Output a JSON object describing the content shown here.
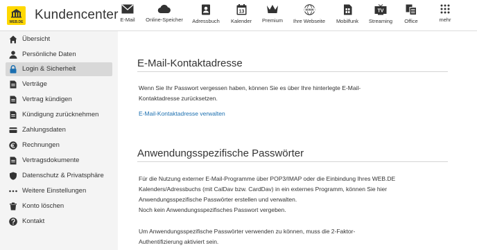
{
  "header": {
    "brand": "Kundencenter",
    "logo_text": "WEB.DE",
    "nav": [
      {
        "label": "E-Mail",
        "icon": "mail-icon"
      },
      {
        "label": "Online-Speicher",
        "icon": "cloud-icon"
      },
      {
        "label": "Adressbuch",
        "icon": "addressbook-icon"
      },
      {
        "label": "Kalender",
        "icon": "calendar-icon",
        "badge": "13"
      },
      {
        "label": "Premium",
        "icon": "crown-icon"
      },
      {
        "label": "Ihre Webseite",
        "icon": "website-icon",
        "badge": "WWW"
      },
      {
        "label": "Mobilfunk",
        "icon": "sim-icon"
      },
      {
        "label": "Streaming",
        "icon": "tv-icon",
        "badge": "TV"
      },
      {
        "label": "Office",
        "icon": "office-icon"
      },
      {
        "label": "mehr",
        "icon": "grid-icon"
      }
    ]
  },
  "sidebar": {
    "items": [
      {
        "label": "Übersicht",
        "icon": "home-icon",
        "active": false
      },
      {
        "label": "Persönliche Daten",
        "icon": "user-icon",
        "active": false
      },
      {
        "label": "Login & Sicherheit",
        "icon": "lock-icon",
        "active": true
      },
      {
        "label": "Verträge",
        "icon": "document-icon",
        "active": false
      },
      {
        "label": "Vertrag kündigen",
        "icon": "document-icon",
        "active": false
      },
      {
        "label": "Kündigung zurücknehmen",
        "icon": "document-icon",
        "active": false
      },
      {
        "label": "Zahlungsdaten",
        "icon": "credit-card-icon",
        "active": false
      },
      {
        "label": "Rechnungen",
        "icon": "euro-icon",
        "active": false
      },
      {
        "label": "Vertragsdokumente",
        "icon": "document-icon",
        "active": false
      },
      {
        "label": "Datenschutz & Privatsphäre",
        "icon": "shield-icon",
        "active": false
      },
      {
        "label": "Weitere Einstellungen",
        "icon": "ellipsis-icon",
        "active": false
      },
      {
        "label": "Konto löschen",
        "icon": "trash-icon",
        "active": false
      },
      {
        "label": "Kontakt",
        "icon": "help-icon",
        "active": false
      }
    ]
  },
  "main": {
    "section1": {
      "title": "E-Mail-Kontaktadresse",
      "text_line1": "Wenn Sie Ihr Passwort vergessen haben, können Sie es über Ihre hinterlegte E-Mail-",
      "text_line2": "Kontaktadresse zurücksetzen.",
      "link": "E-Mail-Kontaktadresse verwalten"
    },
    "section2": {
      "title": "Anwendungsspezifische Passwörter",
      "text_line1": "Für die Nutzung externer E-Mail-Programme über POP3/IMAP oder die Einbindung Ihres WEB.DE",
      "text_line2": "Kalenders/Adressbuchs (mit CalDav bzw. CardDav) in ein externes Programm, können Sie hier",
      "text_line3": "Anwendungsspezifische Passwörter erstellen und verwalten.",
      "text_line4": "Noch kein Anwendungsspezifisches Passwort vergeben.",
      "text_line5": "Um Anwendungsspezifische Passwörter verwenden zu können, muss die 2-Faktor-",
      "text_line6": "Authentifizierung aktiviert sein."
    }
  },
  "colors": {
    "logo_yellow": "#ffd800",
    "link_blue": "#1b6fb0",
    "active_bg": "#d8d8d8"
  }
}
